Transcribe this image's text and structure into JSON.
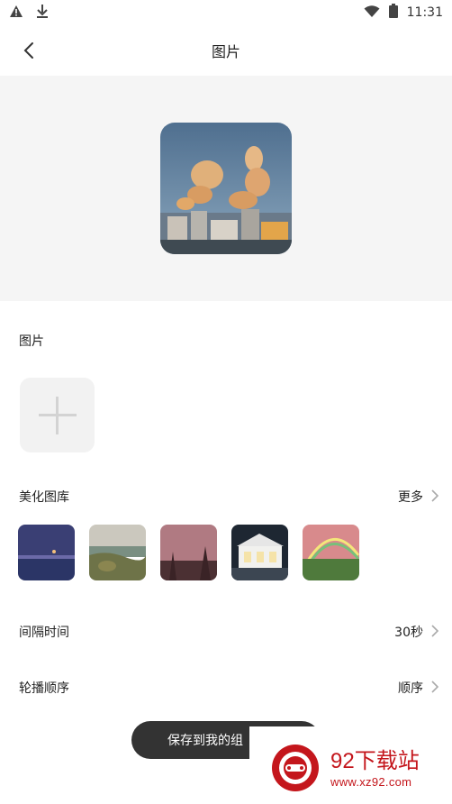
{
  "status_bar": {
    "time": "11:31",
    "icons": [
      "warning-icon",
      "download-icon",
      "wifi-icon",
      "battery-icon"
    ]
  },
  "app_bar": {
    "title": "图片",
    "back_icon": "chevron-left-icon"
  },
  "sections": {
    "picture_label": "图片",
    "gallery": {
      "label": "美化图库",
      "more": "更多"
    },
    "interval": {
      "label": "间隔时间",
      "value": "30秒"
    },
    "order": {
      "label": "轮播顺序",
      "value": "顺序"
    }
  },
  "gallery_items": [
    "night-sea-thumbnail",
    "coast-thumbnail",
    "pink-sky-thumbnail",
    "house-night-thumbnail",
    "rainbow-field-thumbnail"
  ],
  "save_button": {
    "label": "保存到我的组"
  },
  "watermark": {
    "title": "92下载站",
    "url": "www.xz92.com"
  },
  "colors": {
    "accent_red": "#c4161c",
    "button_dark": "#333333",
    "preview_bg": "#f5f5f5"
  }
}
